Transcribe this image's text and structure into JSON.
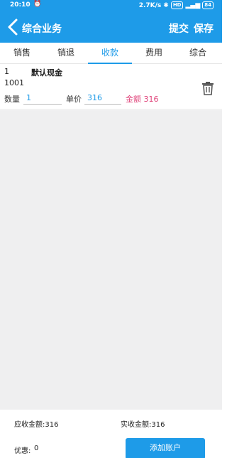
{
  "status_bar": {
    "time": "20:10",
    "network_speed": "2.7K/s",
    "battery": "84"
  },
  "app_bar": {
    "title": "综合业务",
    "submit_label": "提交",
    "save_label": "保存"
  },
  "tabs": [
    {
      "label": "销售",
      "active": false
    },
    {
      "label": "销退",
      "active": false
    },
    {
      "label": "收款",
      "active": true
    },
    {
      "label": "费用",
      "active": false
    },
    {
      "label": "综合",
      "active": false
    }
  ],
  "item": {
    "index": "1",
    "name": "默认现金",
    "code": "1001",
    "qty_label": "数量",
    "qty_value": "1",
    "price_label": "单价",
    "price_value": "316",
    "amount_text": "金额 316"
  },
  "footer": {
    "receivable_text": "应收金额:316",
    "received_text": "实收金额:316",
    "discount_label": "优惠:",
    "discount_value": "0",
    "add_account_label": "添加账户"
  },
  "colors": {
    "accent": "#1e9be8",
    "amount": "#e0457b",
    "background_gray": "#efeff0"
  }
}
